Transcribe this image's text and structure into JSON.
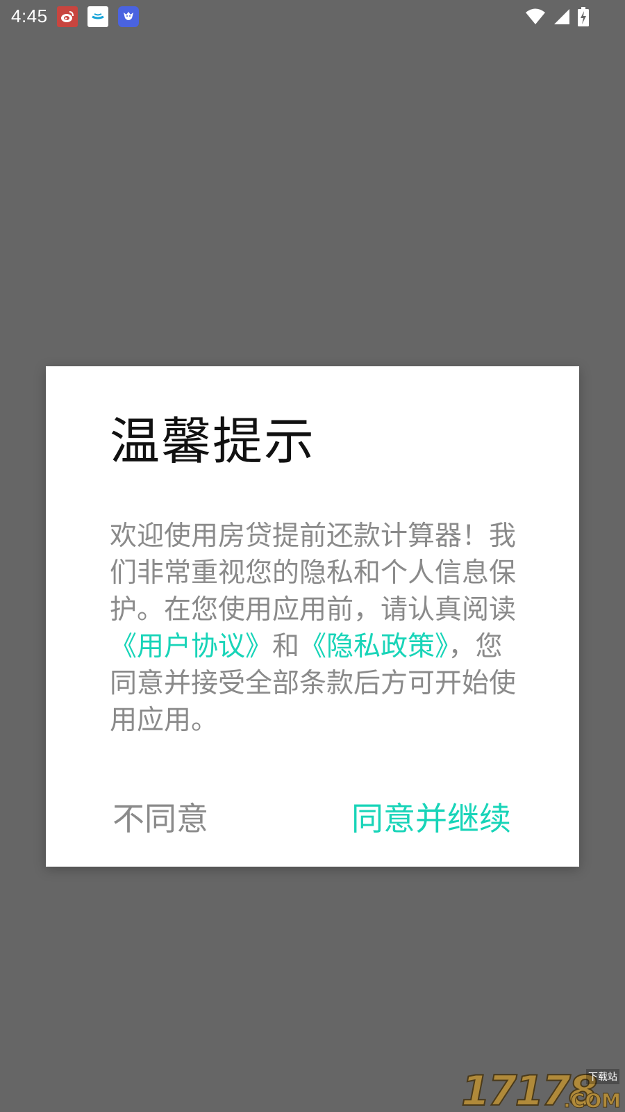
{
  "status_bar": {
    "time": "4:45",
    "notification_icons": [
      "weibo-icon",
      "app-notification-icon",
      "bird-app-icon"
    ],
    "system_icons": [
      "wifi-icon",
      "cell-signal-icon",
      "battery-charging-icon"
    ]
  },
  "dialog": {
    "title": "温馨提示",
    "body": {
      "intro": "欢迎使用房贷提前还款计算器！我们非常重视您的隐私和个人信息保护。在您使用应用前，请认真阅读",
      "user_agreement_link": "《用户协议》",
      "conjunction": "和",
      "privacy_policy_link": "《隐私政策》",
      "outro": "，您同意并接受全部条款后方可开始使用应用。"
    },
    "disagree_button": "不同意",
    "agree_button": "同意并继续"
  },
  "watermark": {
    "digits": "17178",
    "site": "下载站",
    "domain": ".COM"
  },
  "colors": {
    "scrim": "#666666",
    "accent": "#18d4b8",
    "body_text": "#8a8a8a",
    "title_text": "#111111"
  }
}
